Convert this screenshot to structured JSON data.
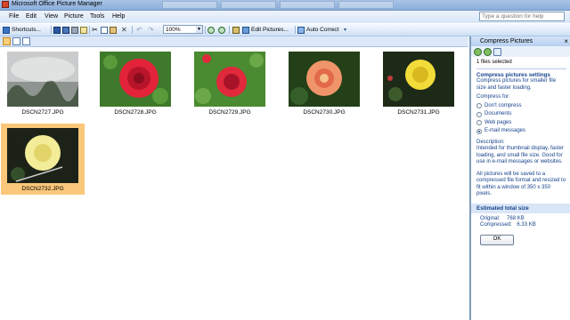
{
  "window": {
    "title": "Microsoft Office Picture Manager"
  },
  "menu": [
    "File",
    "Edit",
    "View",
    "Picture",
    "Tools",
    "Help"
  ],
  "help_box": {
    "placeholder": "Type a question for help"
  },
  "toolbar": {
    "shortcuts": "Shortcuts...",
    "zoom": "100%",
    "edit_pictures": "Edit Pictures...",
    "auto_correct": "Auto Correct"
  },
  "thumbnails": [
    {
      "name": "DSCN2727.JPG",
      "selected": false,
      "scene": "fog"
    },
    {
      "name": "DSCN2728.JPG",
      "selected": false,
      "scene": "red-rose"
    },
    {
      "name": "DSCN2729.JPG",
      "selected": false,
      "scene": "red-rose"
    },
    {
      "name": "DSCN2730.JPG",
      "selected": false,
      "scene": "peach-rose"
    },
    {
      "name": "DSCN2731.JPG",
      "selected": false,
      "scene": "yellow-rose"
    },
    {
      "name": "DSCN2732.JPG",
      "selected": true,
      "scene": "cream-rose"
    }
  ],
  "pane": {
    "title": "Compress Pictures",
    "files_selected": "1 files selected",
    "settings_heading": "Compress pictures settings",
    "settings_desc": "Compress pictures for smaller file size and faster loading.",
    "compress_for_label": "Compress for:",
    "options": [
      {
        "label": "Don't compress",
        "checked": false
      },
      {
        "label": "Documents",
        "checked": false
      },
      {
        "label": "Web pages",
        "checked": false
      },
      {
        "label": "E-mail messages",
        "checked": true
      }
    ],
    "description_label": "Description:",
    "description_text": "Intended for thumbnail display, faster loading, and small file size. Good for use in e-mail messages or websites.",
    "note_text": "All pictures will be saved to a compressed file format and resized to fit within a window of 350 x 350 pixels.",
    "estimated_heading": "Estimated total size",
    "original_label": "Original:",
    "original_value": "768 KB",
    "compressed_label": "Compressed:",
    "compressed_value": "6.33 KB",
    "ok_label": "OK"
  }
}
